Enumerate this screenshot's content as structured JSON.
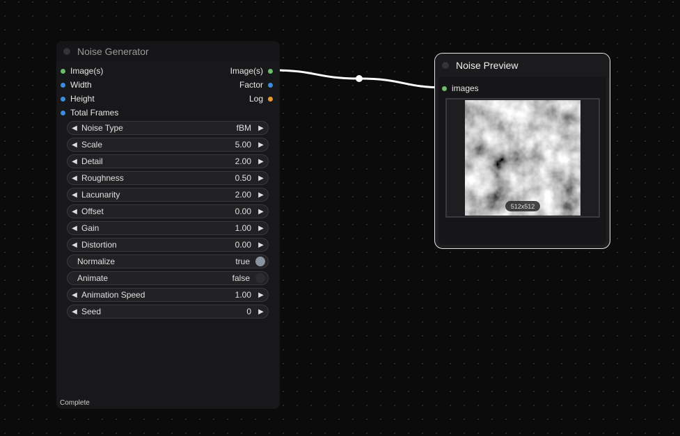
{
  "colors": {
    "slot_image": "#6cbf6a",
    "slot_number": "#3c8de0",
    "slot_log": "#e79a2c",
    "wire": "#ffffff"
  },
  "generator": {
    "title": "Noise Generator",
    "inputs": [
      "Image(s)",
      "Width",
      "Height",
      "Total Frames"
    ],
    "outputs": [
      "Image(s)",
      "Factor",
      "Log"
    ],
    "widgets": {
      "noise_type": {
        "label": "Noise Type",
        "value": "fBM"
      },
      "scale": {
        "label": "Scale",
        "value": "5.00"
      },
      "detail": {
        "label": "Detail",
        "value": "2.00"
      },
      "roughness": {
        "label": "Roughness",
        "value": "0.50"
      },
      "lacunarity": {
        "label": "Lacunarity",
        "value": "2.00"
      },
      "offset": {
        "label": "Offset",
        "value": "0.00"
      },
      "gain": {
        "label": "Gain",
        "value": "1.00"
      },
      "distortion": {
        "label": "Distortion",
        "value": "0.00"
      },
      "normalize": {
        "label": "Normalize",
        "value": "true"
      },
      "animate": {
        "label": "Animate",
        "value": "false"
      },
      "animation_speed": {
        "label": "Animation Speed",
        "value": "1.00"
      },
      "seed": {
        "label": "Seed",
        "value": "0"
      }
    },
    "status": "Complete"
  },
  "preview": {
    "title": "Noise Preview",
    "input": "images",
    "size_label": "512x512"
  }
}
